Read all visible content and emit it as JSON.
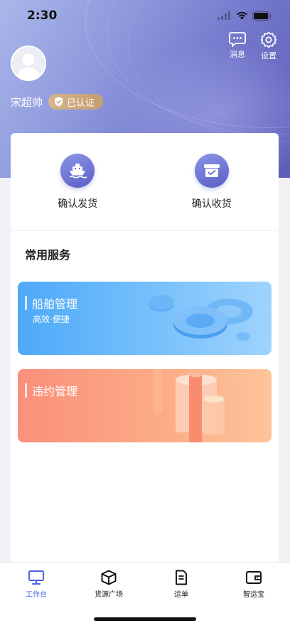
{
  "status_bar": {
    "time": "2:30"
  },
  "header": {
    "messages_label": "消息",
    "settings_label": "设置"
  },
  "user": {
    "name": "宋超帅",
    "verified_label": "已认证"
  },
  "quick_actions": [
    {
      "label": "确认发货",
      "icon": "ship-icon"
    },
    {
      "label": "确认收货",
      "icon": "inbox-check-icon"
    }
  ],
  "services": {
    "section_title": "常用服务",
    "items": [
      {
        "title": "船舶管理",
        "subtitle": "高效·便捷"
      },
      {
        "title": "违约管理",
        "subtitle": ""
      }
    ]
  },
  "tab_bar": {
    "items": [
      {
        "label": "工作台",
        "icon": "monitor-icon",
        "active": true
      },
      {
        "label": "货源广场",
        "icon": "cube-icon",
        "active": false
      },
      {
        "label": "运单",
        "icon": "document-icon",
        "active": false
      },
      {
        "label": "智运宝",
        "icon": "wallet-icon",
        "active": false
      }
    ]
  },
  "colors": {
    "accent": "#4a63e7",
    "hero_gradient": [
      "#a9b7ea",
      "#5b5cb7"
    ],
    "ship_card": "#4ea9f8",
    "violation_card": "#fb8f7b",
    "badge_gold": "#d7b48a"
  }
}
